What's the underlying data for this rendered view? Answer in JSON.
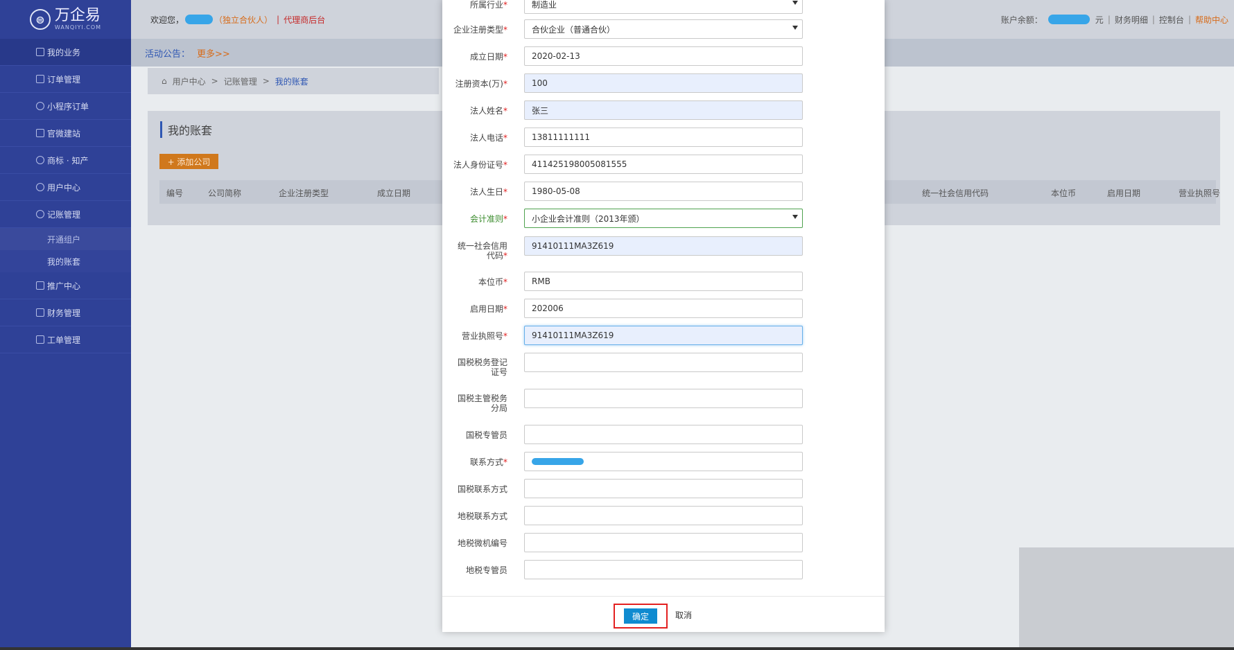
{
  "brand": {
    "name": "万企易",
    "sub": "WANQIYI.COM"
  },
  "sidebar": {
    "items": [
      {
        "label": "我的业务",
        "icon": "briefcase-icon"
      },
      {
        "label": "订单管理",
        "icon": "document-icon"
      },
      {
        "label": "小程序订单",
        "icon": "compass-icon"
      },
      {
        "label": "官微建站",
        "icon": "document-icon"
      },
      {
        "label": "商标 · 知产",
        "icon": "registered-icon"
      },
      {
        "label": "用户中心",
        "icon": "user-icon"
      },
      {
        "label": "记账管理",
        "icon": "user-group-icon"
      },
      {
        "label": "开通组户"
      },
      {
        "label": "我的账套"
      },
      {
        "label": "推广中心",
        "icon": "megaphone-icon"
      },
      {
        "label": "财务管理",
        "icon": "grid-icon"
      },
      {
        "label": "工单管理",
        "icon": "edit-icon"
      }
    ]
  },
  "topbar": {
    "welcome": "欢迎您，",
    "role": "（独立合伙人）",
    "divider": "|",
    "agent_link": "代理商后台",
    "balance_label": "账户余额：",
    "balance_unit": "元",
    "links": [
      "财务明细",
      "控制台",
      "帮助中心"
    ]
  },
  "notice": {
    "label": "活动公告：",
    "more": "更多>>"
  },
  "breadcrumb": {
    "items": [
      "用户中心",
      "记账管理",
      "我的账套"
    ],
    "sep": ">"
  },
  "panel": {
    "title": "我的账套",
    "add_button": "+ 添加公司",
    "columns": [
      "编号",
      "公司简称",
      "企业注册类型",
      "成立日期",
      "统一社会信用代码",
      "本位币",
      "启用日期",
      "营业执照号"
    ]
  },
  "form": {
    "fields": [
      {
        "label": "所属行业",
        "required": true,
        "value": "制造业",
        "type": "select"
      },
      {
        "label": "企业注册类型",
        "required": true,
        "value": "合伙企业（普通合伙）",
        "type": "select"
      },
      {
        "label": "成立日期",
        "required": true,
        "value": "2020-02-13",
        "type": "input"
      },
      {
        "label": "注册资本(万)",
        "required": true,
        "value": "100",
        "type": "input",
        "highlight": true
      },
      {
        "label": "法人姓名",
        "required": true,
        "value": "张三",
        "type": "input",
        "highlight": true
      },
      {
        "label": "法人电话",
        "required": true,
        "value": "13811111111",
        "type": "input"
      },
      {
        "label": "法人身份证号",
        "required": true,
        "value": "411425198005081555",
        "type": "input"
      },
      {
        "label": "法人生日",
        "required": true,
        "value": "1980-05-08",
        "type": "input"
      },
      {
        "label": "会计准则",
        "required": true,
        "value": "小企业会计准则（2013年颁）",
        "type": "select"
      },
      {
        "label_line1": "统一社会信用",
        "label_line2": "代码",
        "required": true,
        "value": "91410111MA3Z619",
        "type": "input",
        "highlight": true
      },
      {
        "label": "本位币",
        "required": true,
        "value": "RMB",
        "type": "input"
      },
      {
        "label": "启用日期",
        "required": true,
        "value": "202006",
        "type": "input"
      },
      {
        "label": "营业执照号",
        "required": true,
        "value": "91410111MA3Z619",
        "type": "input",
        "highlight": true
      },
      {
        "label_line1": "国税税务登记",
        "label_line2": "证号",
        "required": false,
        "value": "",
        "type": "input"
      },
      {
        "label_line1": "国税主管税务",
        "label_line2": "分局",
        "required": false,
        "value": "",
        "type": "input"
      },
      {
        "label": "国税专管员",
        "required": false,
        "value": "",
        "type": "input"
      },
      {
        "label": "联系方式",
        "required": true,
        "value": "",
        "type": "input"
      },
      {
        "label": "国税联系方式",
        "required": false,
        "value": "",
        "type": "input"
      },
      {
        "label": "地税联系方式",
        "required": false,
        "value": "",
        "type": "input"
      },
      {
        "label": "地税微机编号",
        "required": false,
        "value": "",
        "type": "input"
      },
      {
        "label": "地税专管员",
        "required": false,
        "value": "",
        "type": "input"
      }
    ],
    "req_mark": "*",
    "ok_label": "确定",
    "cancel_label": "取消"
  }
}
